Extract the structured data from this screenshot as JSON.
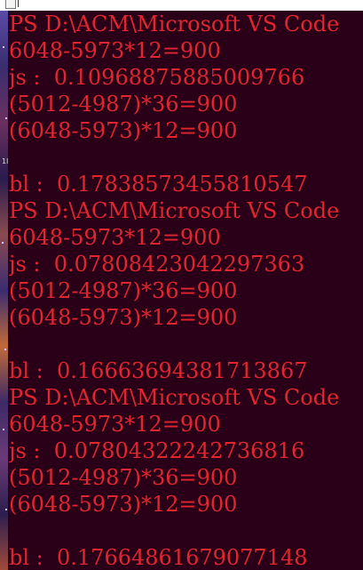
{
  "terminal": {
    "lines": [
      "PS D:\\ACM\\Microsoft VS Code",
      "6048-5973*12=900",
      "js :  0.10968875885009766",
      "(5012-4987)*36=900",
      "(6048-5973)*12=900",
      "",
      "bl :  0.17838573455810547",
      "PS D:\\ACM\\Microsoft VS Code",
      "6048-5973*12=900",
      "js :  0.07808423042297363",
      "(5012-4987)*36=900",
      "(6048-5973)*12=900",
      "",
      "bl :  0.16663694381713867",
      "PS D:\\ACM\\Microsoft VS Code",
      "6048-5973*12=900",
      "js :  0.07804322242736816",
      "(5012-4987)*36=900",
      "(6048-5973)*12=900",
      "",
      "bl :  0.17664861679077148"
    ]
  },
  "side_marker": "1l",
  "colors": {
    "background": "#2a0018",
    "text": "#e0262e"
  }
}
